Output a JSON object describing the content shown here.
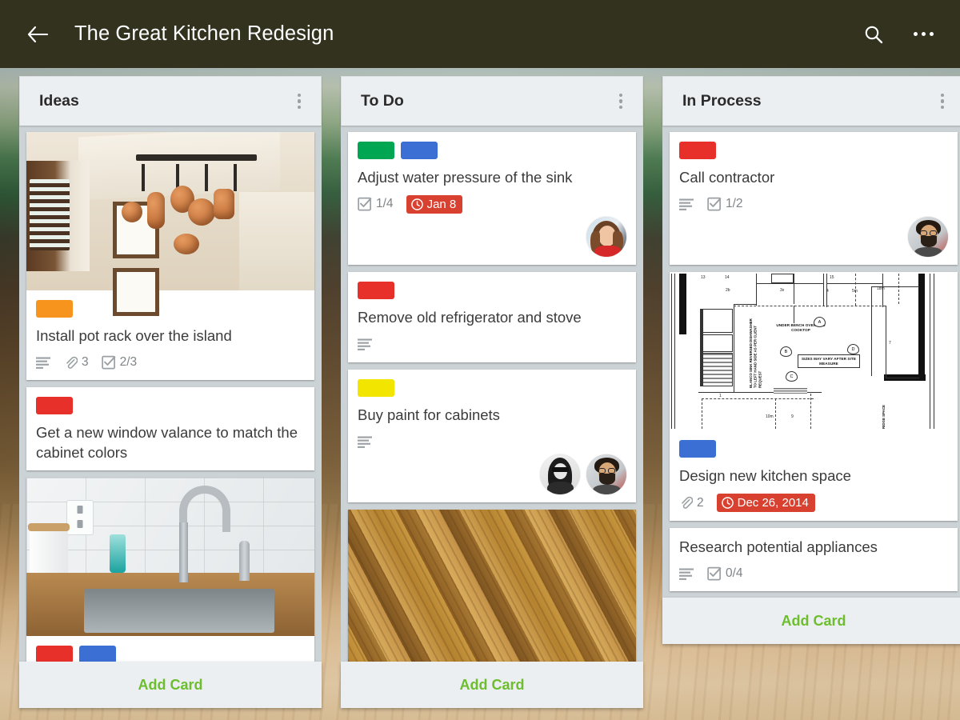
{
  "app_bar": {
    "back_icon": "arrow-left-icon",
    "title": "The Great Kitchen Redesign",
    "search_icon": "search-icon",
    "overflow_icon": "more-horizontal-icon"
  },
  "board": {
    "add_card_label": "Add Card",
    "list_menu_icon": "more-vertical-icon",
    "colors": {
      "green": "#00a651",
      "blue": "#3b6fd4",
      "red": "#e8302a",
      "orange": "#f7941e",
      "yellow": "#f2e500",
      "due_badge": "#d8402f",
      "add_card_text": "#6dbe2e",
      "app_bar": "#32321f"
    },
    "lists": [
      {
        "title": "Ideas",
        "cards": [
          {
            "cover": "kitchen-pot-rack-photo",
            "labels": [
              "orange"
            ],
            "title": "Install pot rack over the island",
            "badges": {
              "description": true,
              "attachments": "3",
              "checklist": "2/3"
            },
            "members": []
          },
          {
            "cover": null,
            "labels": [
              "red"
            ],
            "title": "Get a new window valance to match the cabinet colors",
            "badges": {},
            "members": []
          },
          {
            "cover": "kitchen-sink-photo",
            "labels": [
              "red",
              "blue"
            ],
            "title": "",
            "badges": {},
            "members": []
          }
        ]
      },
      {
        "title": "To Do",
        "cards": [
          {
            "cover": null,
            "labels": [
              "green",
              "blue"
            ],
            "title": "Adjust water pressure of the sink",
            "badges": {
              "checklist": "1/4",
              "due_date": "Jan 8"
            },
            "members": [
              "woman-red-top"
            ]
          },
          {
            "cover": null,
            "labels": [
              "red"
            ],
            "title": "Remove old refrigerator and stove",
            "badges": {
              "description": true
            },
            "members": []
          },
          {
            "cover": null,
            "labels": [
              "yellow"
            ],
            "title": "Buy paint for cabinets",
            "badges": {
              "description": true
            },
            "members": [
              "woman-sunglasses-bw",
              "man-glasses-beard"
            ]
          },
          {
            "cover": "hardwood-floor-photo",
            "labels": [],
            "title": "",
            "badges": {},
            "members": []
          }
        ]
      },
      {
        "title": "In Process",
        "cards": [
          {
            "cover": null,
            "labels": [
              "red"
            ],
            "title": "Call contractor",
            "badges": {
              "description": true,
              "checklist": "1/2"
            },
            "members": [
              "man-glasses-beard"
            ]
          },
          {
            "cover": "kitchen-floor-plan-blueprint",
            "labels": [
              "blue"
            ],
            "title": "Design new kitchen space",
            "badges": {
              "attachments": "2",
              "due_date": "Dec 26, 2014"
            },
            "members": []
          },
          {
            "cover": null,
            "labels": [],
            "title": "Research potential appliances",
            "badges": {
              "description": true,
              "checklist": "0/4"
            },
            "members": []
          }
        ]
      }
    ]
  },
  "blueprint": {
    "note_main": "UNDER BENCH OVEN AND COOKTOP",
    "note_box": "SIZES MAY VARY AFTER SITE MEASURE",
    "note_vertical": "BLANCO SINK REVERSED DISHWASHER TO LEFT HAND SIDE AS PER CLIENT REQUEST",
    "note_ridge": "RIDGE SPACE",
    "tags": [
      "A",
      "B",
      "C",
      "D"
    ],
    "dims": [
      "13",
      "14",
      "2b",
      "3x",
      "15",
      "4",
      "5m",
      "18m",
      "7",
      "10m",
      "9",
      "1"
    ]
  }
}
